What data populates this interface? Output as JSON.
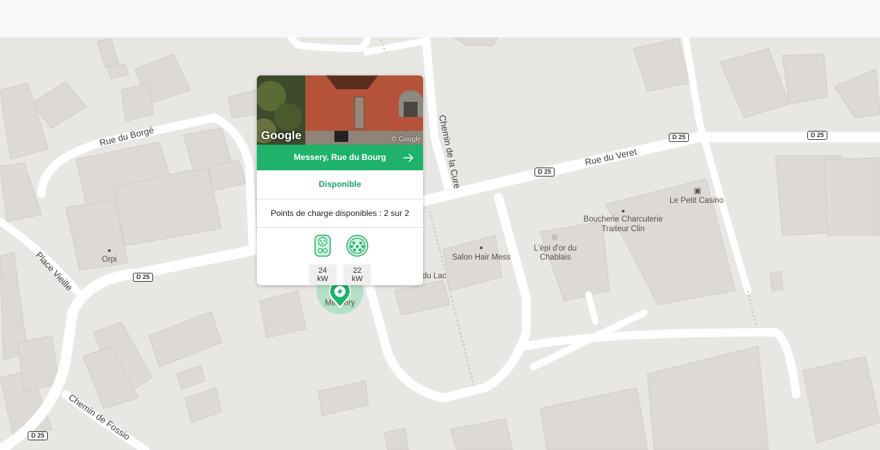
{
  "map": {
    "streets": [
      "Rue du Borgé",
      "Rue du Veret",
      "Chemin de la Cure",
      "Place Vieille",
      "Chemin de Fossio"
    ],
    "road_badge": "D 25",
    "pois": [
      "Orpi",
      "Salon Hair Mess",
      "Boucherie Charcuterie",
      "Traiteur Clin",
      "L'épi d'or du",
      "Chablais",
      "Le Petit Casino",
      "du Lac"
    ],
    "marker_label": "Messery",
    "accent_color": "#1fb26a"
  },
  "popup": {
    "photo_logo": "Google",
    "photo_credit": "© Google",
    "station_name": "Messery, Rue du Bourg",
    "status": "Disponible",
    "points": "Points de charge disponibles : 2 sur 2",
    "connectors": [
      {
        "icon": "ccs-connector-icon",
        "power": "24 kW"
      },
      {
        "icon": "type2-connector-icon",
        "power": "22 kW"
      }
    ]
  }
}
